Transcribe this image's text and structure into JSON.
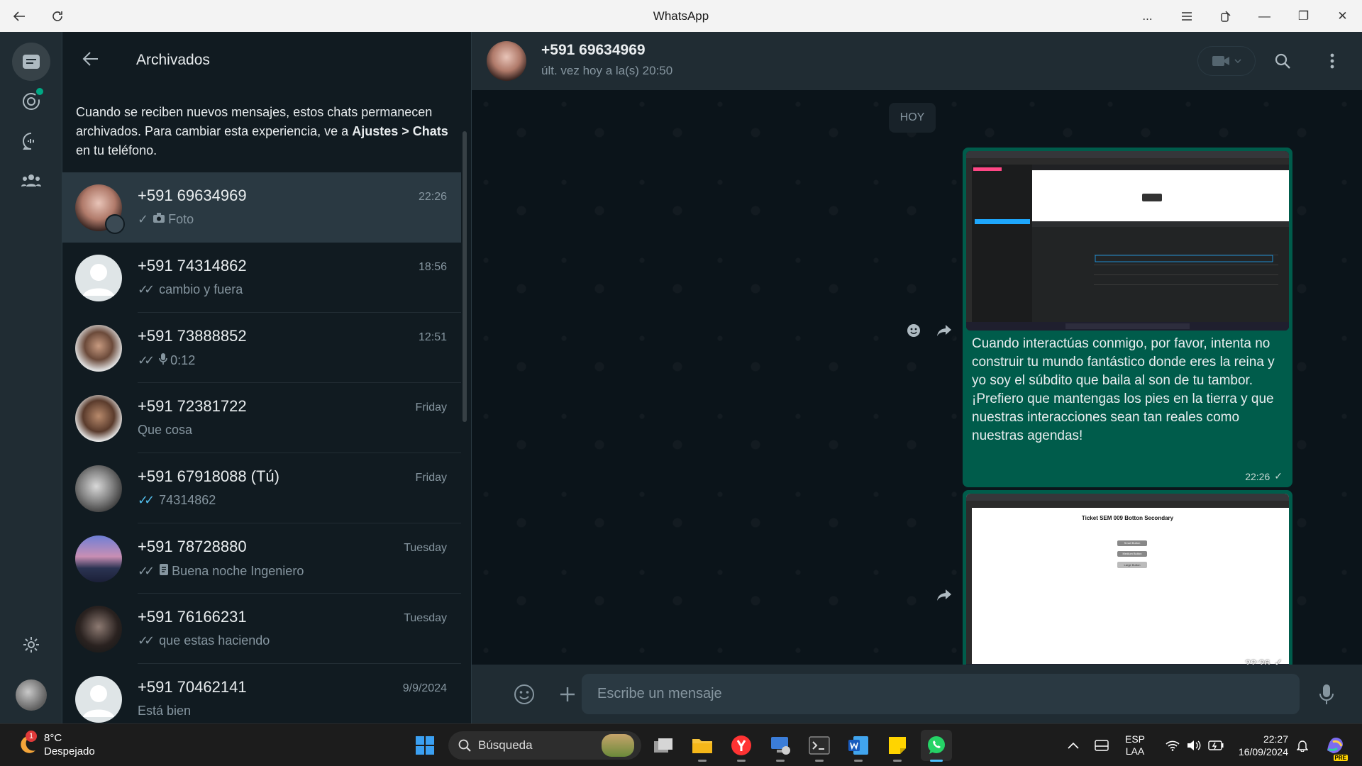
{
  "window": {
    "title": "WhatsApp",
    "more_label": "...",
    "minimize": "—",
    "maximize": "❐",
    "close": "✕"
  },
  "panel": {
    "title": "Archivados",
    "info_parts": [
      "Cuando se reciben nuevos mensajes, estos chats permanecen archivados. Para cambiar esta experiencia, ve a ",
      "Ajustes > Chats",
      " en tu teléfono."
    ]
  },
  "chats": [
    {
      "name": "+591 69634969",
      "time": "22:26",
      "preview": "Foto",
      "tick": "✓",
      "tick_color": "gray",
      "icon": "camera-icon"
    },
    {
      "name": "+591 74314862",
      "time": "18:56",
      "preview": "cambio y fuera",
      "tick": "✓✓",
      "tick_color": "gray",
      "icon": ""
    },
    {
      "name": "+591 73888852",
      "time": "12:51",
      "preview": "0:12",
      "tick": "✓✓",
      "tick_color": "gray",
      "icon": "mic-icon"
    },
    {
      "name": "+591 72381722",
      "time": "Friday",
      "preview": "Que cosa",
      "tick": "",
      "tick_color": "",
      "icon": ""
    },
    {
      "name": "+591 67918088 (Tú)",
      "time": "Friday",
      "preview": "74314862",
      "tick": "✓✓",
      "tick_color": "blue",
      "icon": ""
    },
    {
      "name": "+591 78728880",
      "time": "Tuesday",
      "preview": "Buena noche Ingeniero",
      "tick": "✓✓",
      "tick_color": "gray",
      "icon": "document-icon"
    },
    {
      "name": "+591 76166231",
      "time": "Tuesday",
      "preview": "que estas haciendo",
      "tick": "✓✓",
      "tick_color": "gray",
      "icon": ""
    },
    {
      "name": "+591 70462141",
      "time": "9/9/2024",
      "preview": "Está bien",
      "tick": "",
      "tick_color": "",
      "icon": ""
    }
  ],
  "conversation": {
    "contact": "+591 69634969",
    "last_seen": "últ. vez hoy a la(s) 20:50",
    "day_chip": "HOY",
    "messages": [
      {
        "type": "image_caption",
        "caption": "Cuando interactúas conmigo, por favor, intenta no construir tu mundo fantástico donde eres la reina y yo soy el súbdito que baila al son de tu tambor. ¡Prefiero que mantengas los pies en la tierra y que nuestras interacciones sean tan reales como nuestras agendas!",
        "time": "22:26",
        "tick": "✓"
      },
      {
        "type": "image",
        "time": "22:26",
        "tick": "✓",
        "image_title": "Ticket SEM 009 Botton Secondary",
        "image_buttons": [
          "Small Button",
          "Medium Button",
          "Large Button"
        ],
        "image_small_button": "Button"
      }
    ],
    "composer_placeholder": "Escribe un mensaje"
  },
  "taskbar": {
    "weather_temp": "8°C",
    "weather_desc": "Despejado",
    "weather_badge": "1",
    "search_label": "Búsqueda",
    "lang_top": "ESP",
    "lang_bottom": "LAA",
    "clock_time": "22:27",
    "clock_date": "16/09/2024",
    "copilot_badge": "PRE"
  },
  "colors": {
    "accent": "#00a884",
    "bubble_out": "#005c4b",
    "read_tick": "#53bdeb"
  }
}
